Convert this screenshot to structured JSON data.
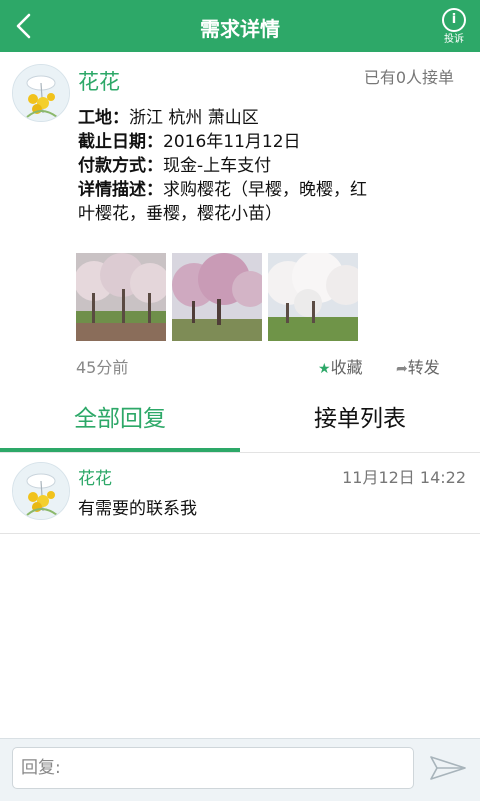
{
  "header": {
    "title": "需求详情",
    "complain_label": "投诉",
    "complain_icon_text": "i"
  },
  "post": {
    "user_name": "花花",
    "accept_count": "已有0人接单",
    "fields": [
      {
        "label": "工地：",
        "value": "浙江 杭州 萧山区"
      },
      {
        "label": "截止日期：",
        "value": "2016年11月12日"
      },
      {
        "label": "付款方式：",
        "value": "现金-上车支付"
      },
      {
        "label": "详情描述：",
        "value": "求购樱花（早樱，晚樱，红叶樱花，垂樱，樱花小苗）"
      }
    ],
    "time": "45分前",
    "favorite_label": "收藏",
    "share_label": "转发",
    "favorite_icon": "star-icon",
    "share_icon": "share-arrow-icon"
  },
  "tabs": [
    {
      "label": "全部回复",
      "active": true
    },
    {
      "label": "接单列表",
      "active": false
    }
  ],
  "replies": [
    {
      "user_name": "花花",
      "time": "11月12日 14:22",
      "text": "有需要的联系我"
    }
  ],
  "reply_bar": {
    "placeholder": "回复:",
    "value": ""
  },
  "colors": {
    "brand": "#2da868",
    "header_bg": "#2da868"
  }
}
